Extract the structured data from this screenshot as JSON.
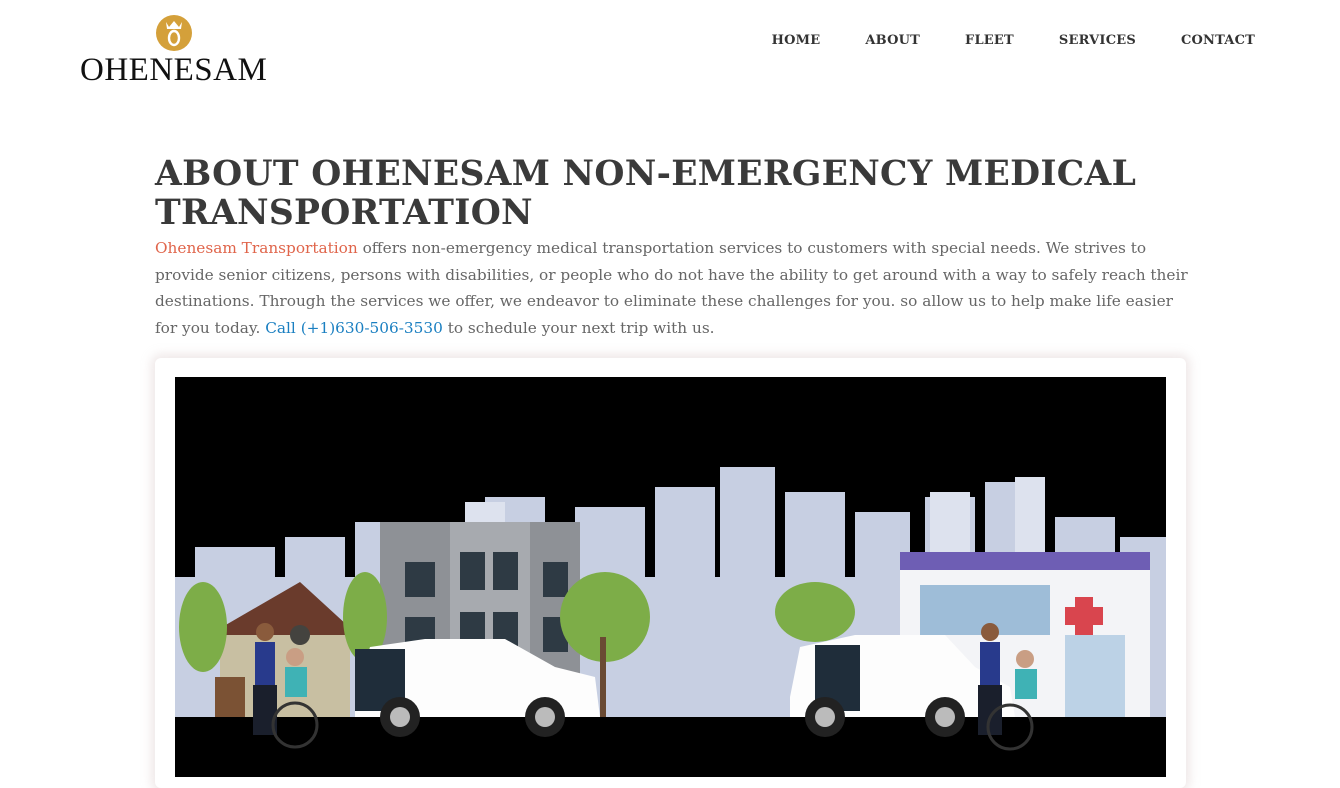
{
  "brand": {
    "logo_text": "OHENESAM",
    "logo_icon": "crown-emblem-icon",
    "accent": "#d4a03a"
  },
  "nav": {
    "items": [
      {
        "label": "HOME"
      },
      {
        "label": "ABOUT"
      },
      {
        "label": "FLEET"
      },
      {
        "label": "SERVICES"
      },
      {
        "label": "CONTACT"
      }
    ]
  },
  "main": {
    "heading": "ABOUT OHENESAM NON-EMERGENCY MEDICAL TRANSPORTATION",
    "intro": {
      "brand_link": "Ohenesam Transportation",
      "text_1": " offers non-emergency medical transportation services to customers with special needs. We strives to provide senior citizens, persons with disabilities, or people who do not have the ability to get around with a way to safely reach their destinations. Through the services we offer, we endeavor to eliminate these challenges for you. so allow us to help make life easier for you today. ",
      "phone_link": "Call (+1)630-506-3530",
      "text_2": " to schedule your next trip with us."
    }
  },
  "colors": {
    "brand_link": "#e0654b",
    "phone_link": "#1a7fc1",
    "heading": "#3a3a3a"
  }
}
